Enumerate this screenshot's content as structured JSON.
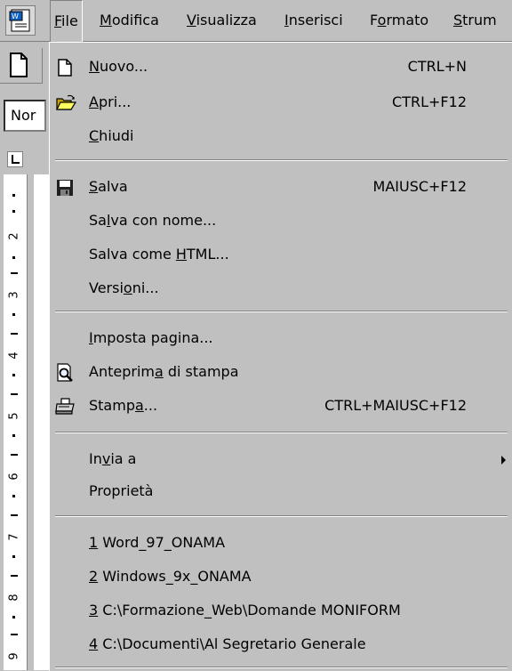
{
  "menubar": {
    "items": [
      {
        "pre": "",
        "ul": "F",
        "post": "ile"
      },
      {
        "pre": "",
        "ul": "M",
        "post": "odifica"
      },
      {
        "pre": "",
        "ul": "V",
        "post": "isualizza"
      },
      {
        "pre": "",
        "ul": "I",
        "post": "nserisci"
      },
      {
        "pre": "F",
        "ul": "o",
        "post": "rmato"
      },
      {
        "pre": "",
        "ul": "S",
        "post": "trum"
      }
    ]
  },
  "style_box": {
    "value": "Nor"
  },
  "ruler": {
    "numbers": [
      "2",
      "3",
      "4",
      "5",
      "6",
      "7",
      "8",
      "9"
    ]
  },
  "file_menu": {
    "new": {
      "pre": "",
      "ul": "N",
      "post": "uovo...",
      "shortcut": "CTRL+N"
    },
    "open": {
      "pre": "",
      "ul": "A",
      "post": "pri...",
      "shortcut": "CTRL+F12"
    },
    "close": {
      "pre": "",
      "ul": "C",
      "post": "hiudi"
    },
    "save": {
      "pre": "",
      "ul": "S",
      "post": "alva",
      "shortcut": "MAIUSC+F12"
    },
    "save_as": {
      "pre": "Sa",
      "ul": "l",
      "post": "va con nome..."
    },
    "save_html": {
      "pre": "Salva come ",
      "ul": "H",
      "post": "TML..."
    },
    "versions": {
      "pre": "Versi",
      "ul": "o",
      "post": "ni..."
    },
    "page_setup": {
      "pre": "",
      "ul": "I",
      "post": "mposta pagina..."
    },
    "print_preview": {
      "pre": "Anteprim",
      "ul": "a",
      "post": " di stampa"
    },
    "print": {
      "pre": "Stamp",
      "ul": "a",
      "post": "...",
      "shortcut": "CTRL+MAIUSC+F12"
    },
    "send_to": {
      "pre": "In",
      "ul": "v",
      "post": "ia a"
    },
    "properties": {
      "pre": "",
      "ul": "",
      "post": "Proprietà"
    },
    "recent": [
      {
        "ul": "1",
        "post": " Word_97_ONAMA"
      },
      {
        "ul": "2",
        "post": " Windows_9x_ONAMA"
      },
      {
        "ul": "3",
        "post": " C:\\Formazione_Web\\Domande MONIFORM"
      },
      {
        "ul": "4",
        "post": " C:\\Documenti\\Al Segretario Generale"
      }
    ]
  }
}
